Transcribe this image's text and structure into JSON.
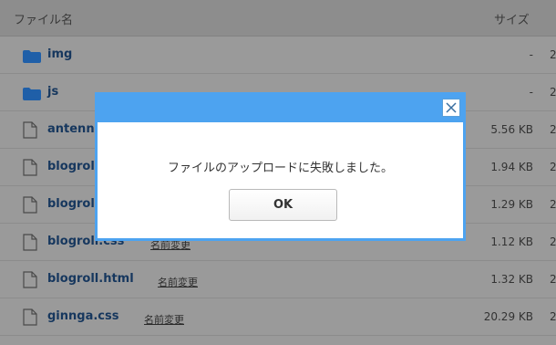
{
  "header": {
    "name_col": "ファイル名",
    "size_col": "サイズ"
  },
  "files": [
    {
      "name": "img",
      "type": "folder",
      "rename": "",
      "size": "-",
      "date": "2"
    },
    {
      "name": "js",
      "type": "folder",
      "rename": "",
      "size": "-",
      "date": "2"
    },
    {
      "name": "antenn",
      "type": "file",
      "rename": "",
      "size": "5.56 KB",
      "date": "2"
    },
    {
      "name": "blogrol",
      "type": "file",
      "rename": "",
      "size": "1.94 KB",
      "date": "2"
    },
    {
      "name": "blogrol",
      "type": "file",
      "rename": "",
      "size": "1.29 KB",
      "date": "2"
    },
    {
      "name": "blogroll.css",
      "type": "file",
      "rename": "名前変更",
      "size": "1.12 KB",
      "date": "2"
    },
    {
      "name": "blogroll.html",
      "type": "file",
      "rename": "名前変更",
      "size": "1.32 KB",
      "date": "2"
    },
    {
      "name": "ginnga.css",
      "type": "file",
      "rename": "名前変更",
      "size": "20.29 KB",
      "date": "2"
    }
  ],
  "dialog": {
    "message": "ファイルのアップロードに失敗しました。",
    "ok_label": "OK"
  },
  "colors": {
    "dialog_accent": "#4da3f0",
    "link": "#16375e",
    "folder": "#1f5fa8"
  }
}
